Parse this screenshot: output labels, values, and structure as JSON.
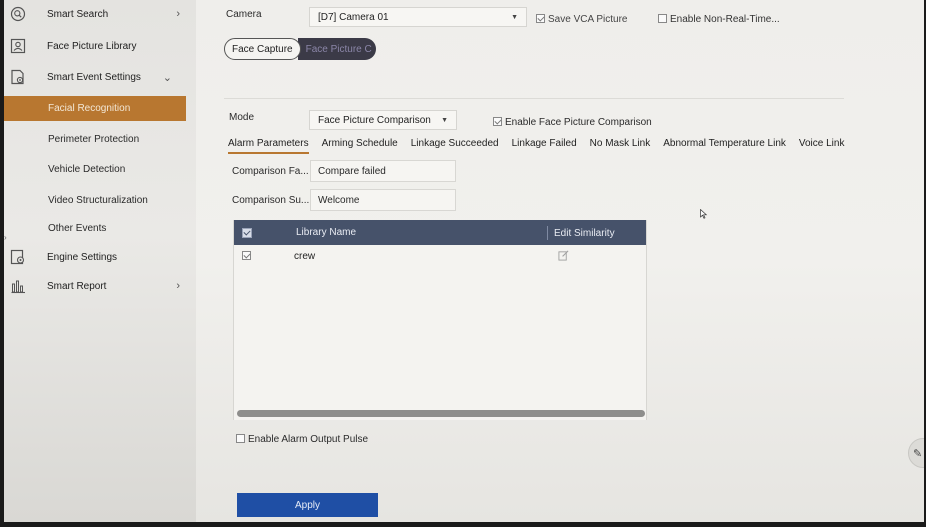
{
  "sidebar": {
    "items": [
      {
        "label": "Smart Search",
        "icon": "search-icon",
        "chevron": "›"
      },
      {
        "label": "Face Picture Library",
        "icon": "face-library-icon"
      },
      {
        "label": "Smart Event Settings",
        "icon": "event-settings-icon",
        "chevron": "⌄"
      },
      {
        "label": "Facial Recognition",
        "active": true
      },
      {
        "label": "Perimeter Protection"
      },
      {
        "label": "Vehicle Detection"
      },
      {
        "label": "Video Structuralization"
      },
      {
        "label": "Other Events"
      },
      {
        "label": "Engine Settings",
        "icon": "engine-settings-icon"
      },
      {
        "label": "Smart Report",
        "icon": "chart-icon",
        "chevron": "›"
      }
    ]
  },
  "camera": {
    "label": "Camera",
    "value": "[D7] Camera 01",
    "save_vca": "Save VCA Picture",
    "save_vca_checked": true,
    "non_realtime": "Enable Non-Real-Time...",
    "non_realtime_checked": false
  },
  "mode_tabs": {
    "face_capture": "Face Capture",
    "face_compare": "Face Picture C"
  },
  "mode": {
    "label": "Mode",
    "value": "Face Picture Comparison",
    "enable_label": "Enable Face Picture Comparison",
    "enable_checked": true
  },
  "tabs": [
    {
      "label": "Alarm Parameters",
      "active": true
    },
    {
      "label": "Arming Schedule"
    },
    {
      "label": "Linkage Succeeded"
    },
    {
      "label": "Linkage Failed"
    },
    {
      "label": "No Mask Link"
    },
    {
      "label": "Abnormal Temperature Link"
    },
    {
      "label": "Voice Link"
    }
  ],
  "fields": {
    "failed_label": "Comparison Fa...",
    "failed_value": "Compare failed",
    "success_label": "Comparison Su...",
    "success_value": "Welcome"
  },
  "table": {
    "headers": {
      "name": "Library Name",
      "similarity": "Edit Similarity"
    },
    "rows": [
      {
        "name": "crew",
        "checked": true
      }
    ]
  },
  "alarm_pulse": {
    "label": "Enable Alarm Output Pulse",
    "checked": false
  },
  "apply_label": "Apply",
  "colors": {
    "accent": "#b87730",
    "header": "#46526a",
    "apply": "#1f4fa5"
  }
}
